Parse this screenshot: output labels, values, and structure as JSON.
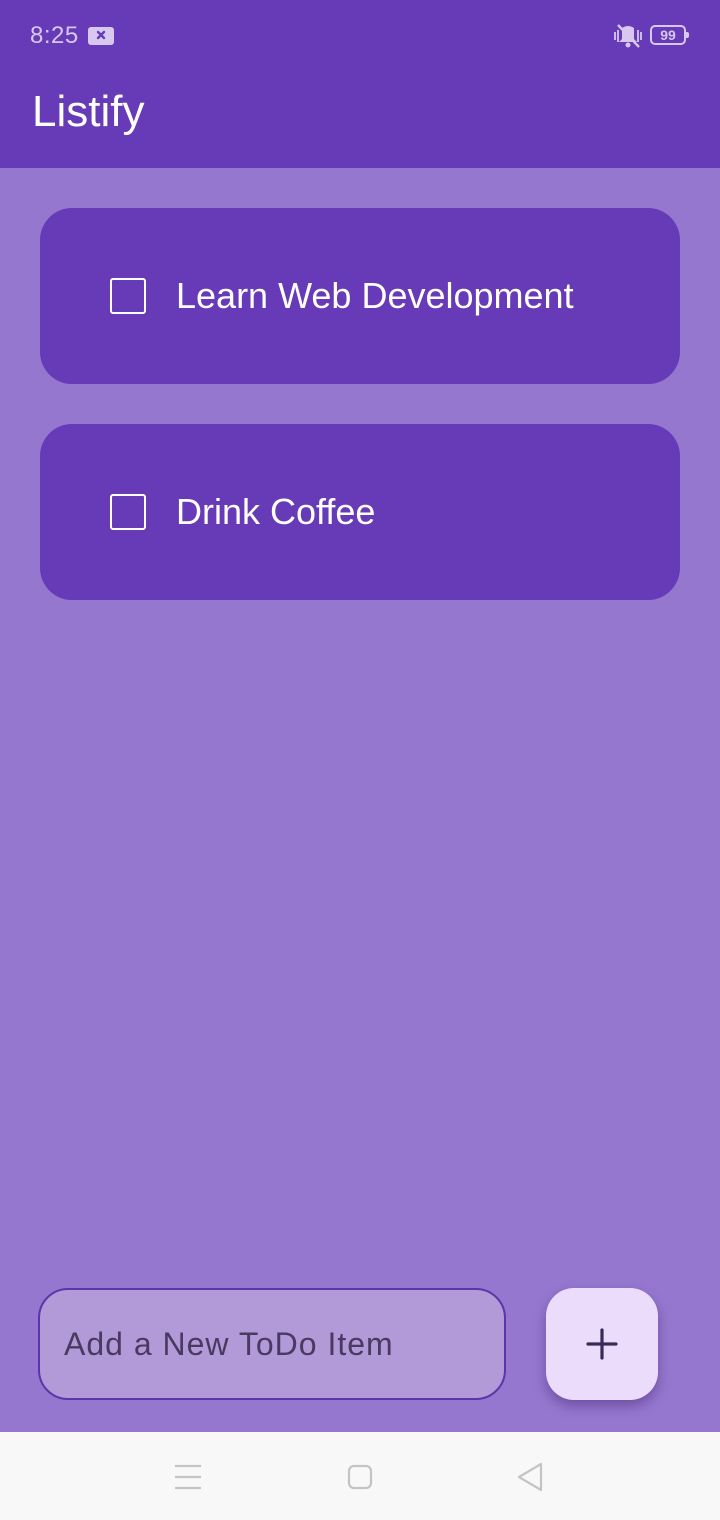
{
  "status_bar": {
    "time": "8:25",
    "battery_level": "99",
    "icons": [
      "notification-x-icon",
      "vibrate-off-icon",
      "battery-icon"
    ]
  },
  "app_bar": {
    "title": "Listify"
  },
  "todos": [
    {
      "text": "Learn Web Development",
      "checked": false
    },
    {
      "text": "Drink Coffee",
      "checked": false
    }
  ],
  "input": {
    "placeholder": "Add a New ToDo Item",
    "value": ""
  },
  "add_button": {
    "icon": "plus-icon"
  },
  "nav_bar": {
    "icons": [
      "menu-icon",
      "home-icon",
      "back-icon"
    ]
  },
  "colors": {
    "primary": "#673ab7",
    "background": "#9577cf",
    "input_fill": "#b29ad8",
    "fab": "#ecdcfc",
    "nav_bar": "#f8f8f8"
  }
}
